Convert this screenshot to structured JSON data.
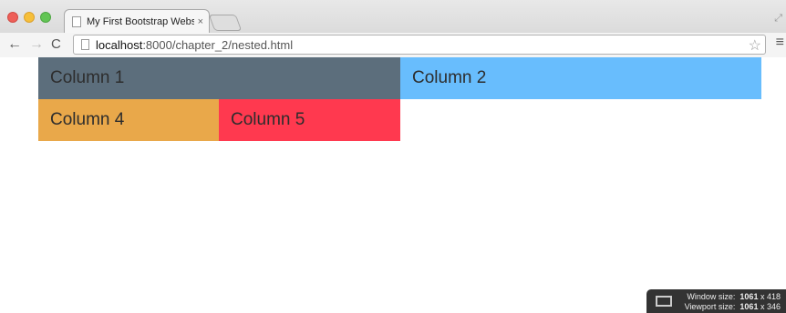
{
  "browser": {
    "tab_title": "My First Bootstrap Website",
    "tab_close": "×",
    "url_host": "localhost",
    "url_rest": ":8000/chapter_2/nested.html"
  },
  "icons": {
    "back": "arrow-left-icon",
    "forward": "arrow-right-icon",
    "reload": "reload-icon",
    "star": "star-icon",
    "menu": "menu-icon"
  },
  "columns": {
    "col1": {
      "label": "Column 1",
      "color": "#5c6e7c"
    },
    "col2": {
      "label": "Column 2",
      "color": "#68bdfd"
    },
    "col4": {
      "label": "Column 4",
      "color": "#e9a84a"
    },
    "col5": {
      "label": "Column 5",
      "color": "#ff394f"
    }
  },
  "overlay": {
    "window_label": "Window size:",
    "window_w": "1061",
    "window_h": "x 418",
    "viewport_label": "Viewport size:",
    "viewport_w": "1061",
    "viewport_h": "x 346"
  }
}
